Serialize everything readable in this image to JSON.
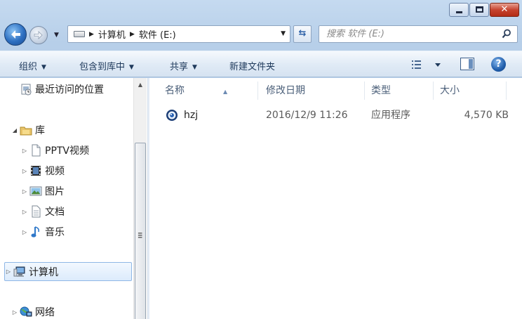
{
  "window": {
    "minimize_glyph": "minimize-icon",
    "maximize_glyph": "maximize-icon",
    "close_glyph": "✕"
  },
  "address": {
    "crumbs": [
      "计算机",
      "软件 (E:)"
    ],
    "search_placeholder": "搜索 软件 (E:)"
  },
  "toolbar": {
    "organize": "组织",
    "include_library": "包含到库中",
    "share": "共享",
    "new_folder": "新建文件夹",
    "help": "?"
  },
  "nav": {
    "items": [
      {
        "label": "最近访问的位置",
        "icon": "recent-places-icon"
      },
      {
        "label": "库",
        "icon": "library-icon"
      },
      {
        "label": "PPTV视频",
        "icon": "document-icon"
      },
      {
        "label": "视频",
        "icon": "video-icon"
      },
      {
        "label": "图片",
        "icon": "picture-icon"
      },
      {
        "label": "文档",
        "icon": "document-icon"
      },
      {
        "label": "音乐",
        "icon": "music-icon"
      },
      {
        "label": "计算机",
        "icon": "computer-icon"
      },
      {
        "label": "网络",
        "icon": "network-icon"
      }
    ]
  },
  "columns": {
    "name": "名称",
    "modified": "修改日期",
    "type": "类型",
    "size": "大小"
  },
  "files": [
    {
      "name": "hzj",
      "modified": "2016/12/9 11:26",
      "type": "应用程序",
      "size": "4,570 KB",
      "icon": "application-icon"
    }
  ],
  "colors": {
    "selection_border": "#8fb7e6",
    "command_text": "#1e395b",
    "column_header_text": "#4c607a"
  }
}
